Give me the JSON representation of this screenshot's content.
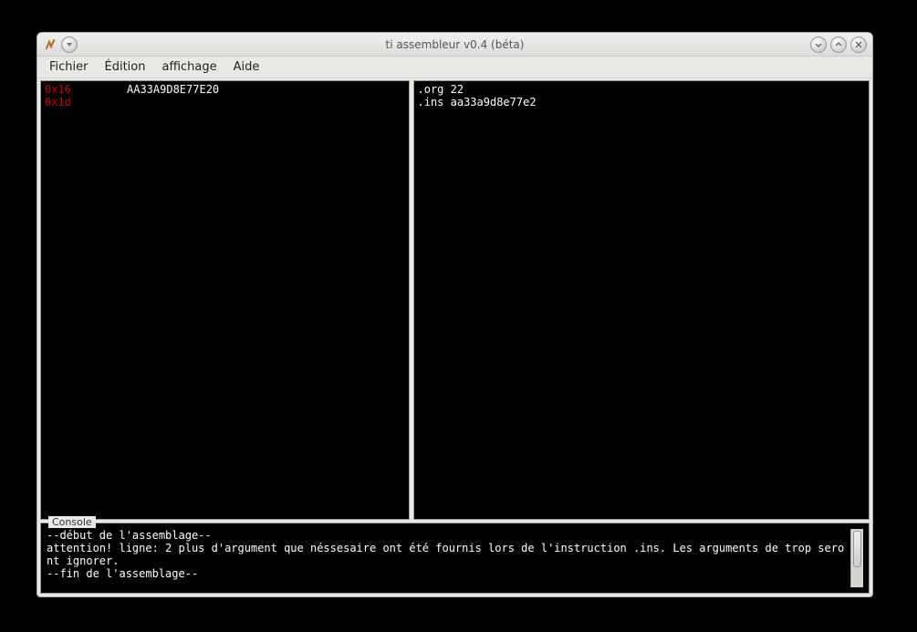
{
  "window": {
    "title": "ti assembleur v0.4 (béta)"
  },
  "menubar": {
    "items": [
      "Fichier",
      "Édition",
      "affichage",
      "Aide"
    ]
  },
  "listing": {
    "rows": [
      {
        "addr": "0x16",
        "hex": "AA33A9D8E77E20"
      },
      {
        "addr": "0x1d",
        "hex": ""
      }
    ]
  },
  "source": {
    "lines": [
      ".org 22",
      ".ins aa33a9d8e77e2"
    ]
  },
  "console": {
    "label": "Console",
    "text": "--début de l'assemblage--\nattention! ligne: 2 plus d'argument que néssesaire ont été fournis lors de l'instruction .ins. Les arguments de trop seront ignorer.\n--fin de l'assemblage--"
  }
}
